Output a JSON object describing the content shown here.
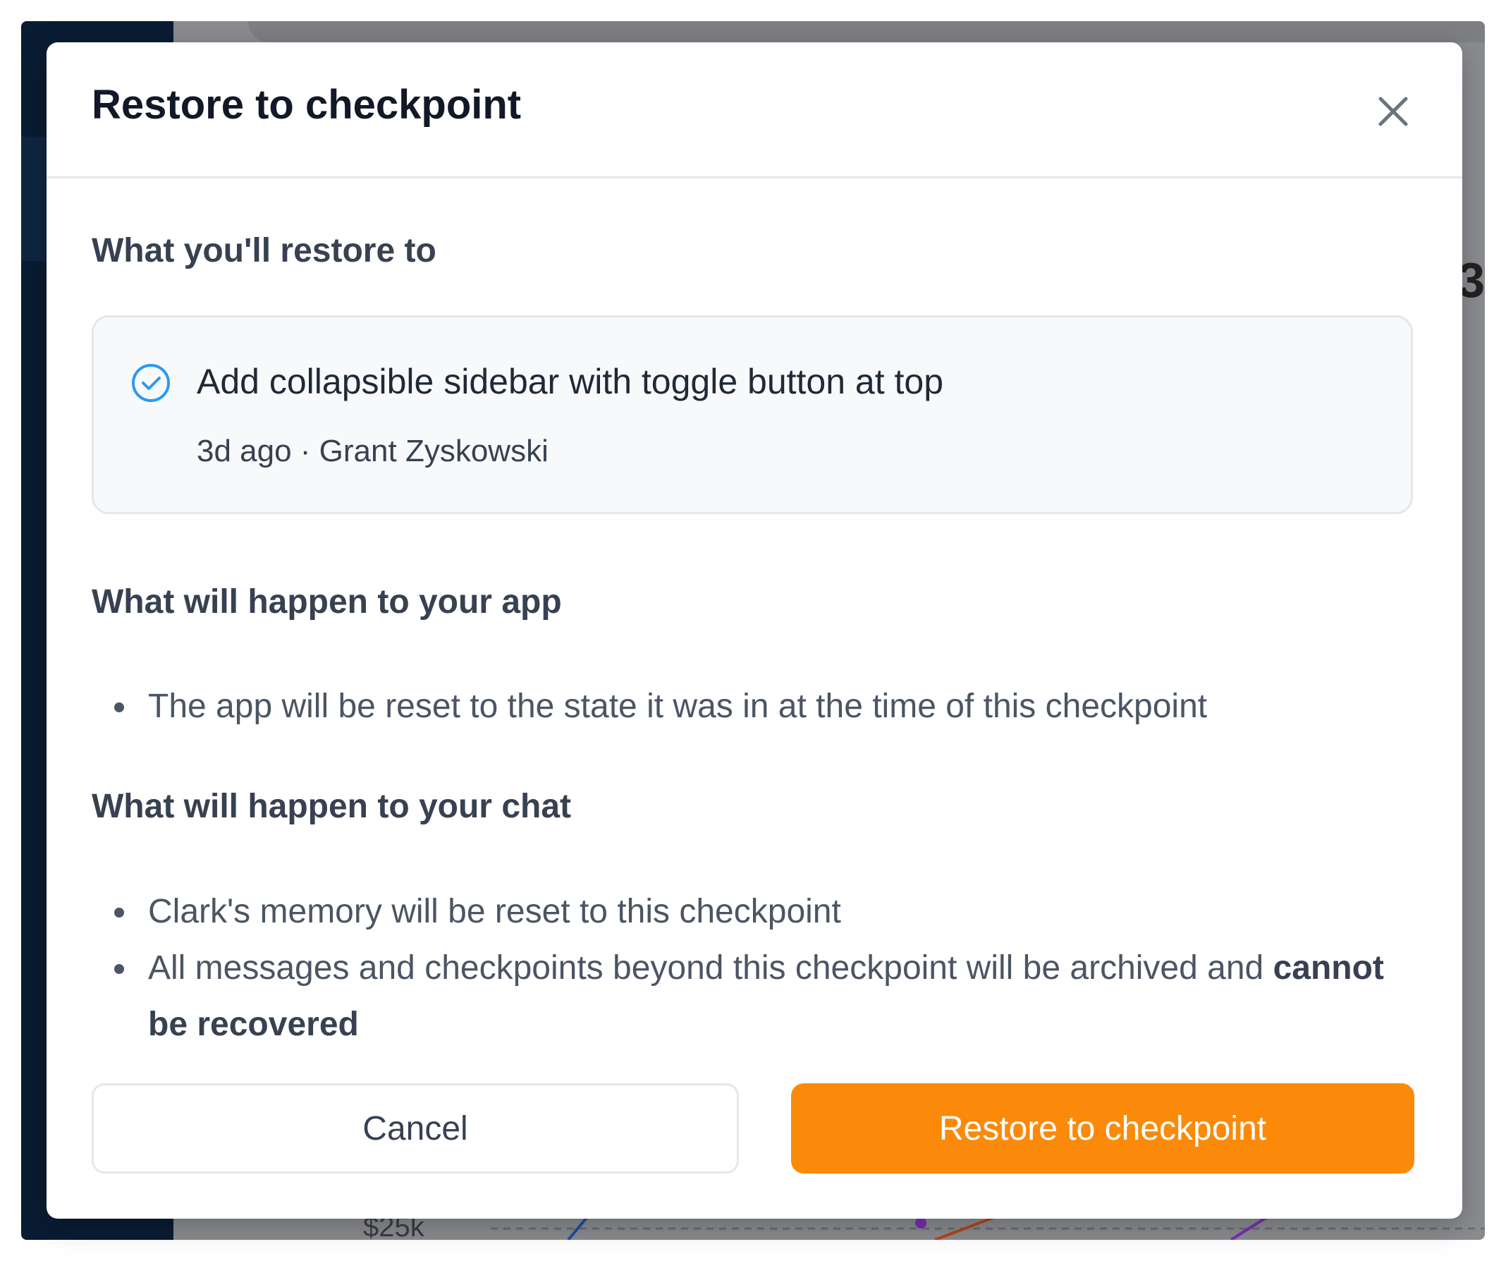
{
  "dialog": {
    "title": "Restore to checkpoint",
    "close_icon": "close-icon"
  },
  "restore_section": {
    "heading": "What you'll restore to",
    "checkpoint": {
      "icon": "check-circle-icon",
      "title": "Add collapsible sidebar with toggle button at top",
      "meta": "3d ago · Grant Zyskowski"
    }
  },
  "app_section": {
    "heading": "What will happen to your app",
    "bullets": [
      "The app will be reset to the state it was in at the time of this checkpoint"
    ]
  },
  "chat_section": {
    "heading": "What will happen to your chat",
    "bullets": [
      "Clark's memory will be reset to this checkpoint",
      "All messages and checkpoints beyond this checkpoint will be archived and "
    ],
    "emphasis": "cannot be recovered"
  },
  "buttons": {
    "cancel_label": "Cancel",
    "restore_label": "Restore to checkpoint"
  },
  "background": {
    "chart_tick_label": "$25k"
  },
  "colors": {
    "accent": "#fb8a0a",
    "check_icon": "#2b9af3",
    "sidebar": "#0a1c33",
    "overlay": "#8a8c8f"
  }
}
